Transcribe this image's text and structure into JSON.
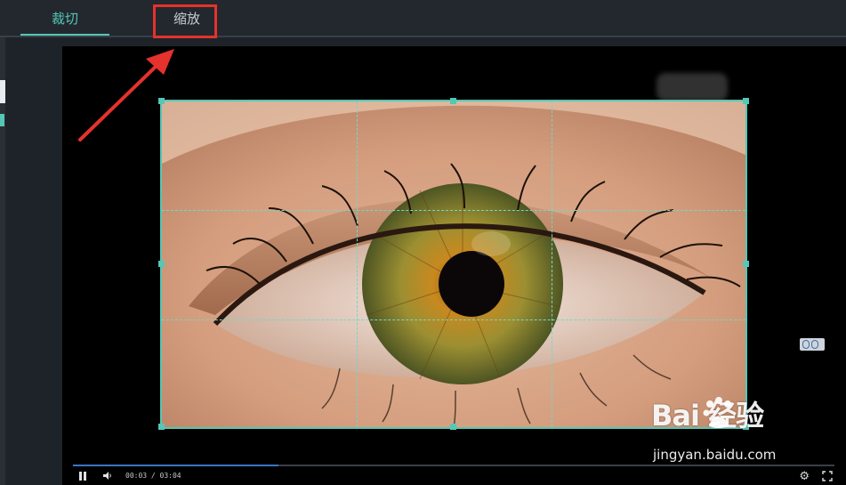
{
  "tabs": [
    {
      "label": "裁切",
      "active": true
    },
    {
      "label": "缩放",
      "active": false
    }
  ],
  "player": {
    "timecode": "00:03 / 03:04",
    "progress_fraction": 0.27
  },
  "watermark": {
    "logo_text": "Bai  经验",
    "url": "jingyan.baidu.com"
  },
  "colors": {
    "accent": "#55c7b7",
    "annotation_red": "#e5322d",
    "progress": "#3a75c4"
  },
  "icons": [
    "pause-icon",
    "volume-icon",
    "settings-gear-icon",
    "fullscreen-icon",
    "annotation-arrow"
  ]
}
